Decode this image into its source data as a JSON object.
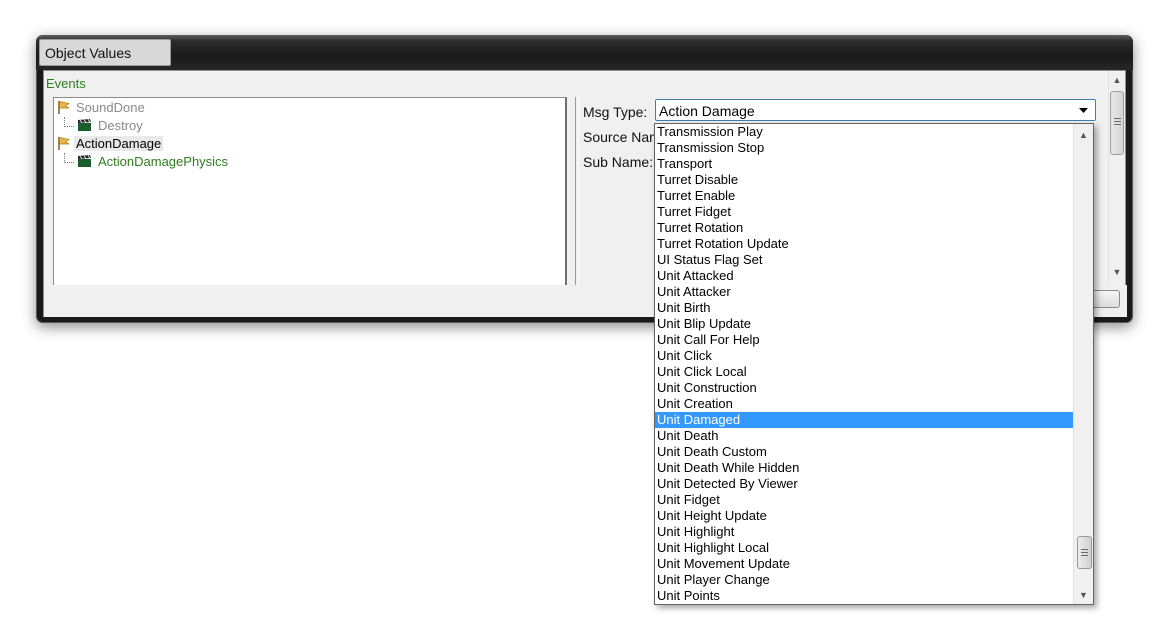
{
  "window": {
    "title": "Object Values"
  },
  "events_label": "Events",
  "tree": {
    "items": [
      {
        "label": "SoundDone",
        "icon": "flag-icon",
        "color": "#8a8a8a"
      },
      {
        "label": "Destroy",
        "icon": "clapperboard-icon",
        "color": "#8a8a8a"
      },
      {
        "label": "ActionDamage",
        "icon": "flag-icon",
        "color": "#000000",
        "selected": true
      },
      {
        "label": "ActionDamagePhysics",
        "icon": "clapperboard-icon",
        "color": "#2e7d1f"
      }
    ]
  },
  "properties": {
    "msg_type_label": "Msg Type:",
    "source_name_label": "Source Nan",
    "sub_name_label": "Sub Name:",
    "msg_type_value": "Action Damage"
  },
  "dropdown": {
    "options": [
      "Transmission Play",
      "Transmission Stop",
      "Transport",
      "Turret Disable",
      "Turret Enable",
      "Turret Fidget",
      "Turret Rotation",
      "Turret Rotation Update",
      "UI Status Flag Set",
      "Unit Attacked",
      "Unit Attacker",
      "Unit Birth",
      "Unit Blip Update",
      "Unit Call For Help",
      "Unit Click",
      "Unit Click Local",
      "Unit Construction",
      "Unit Creation",
      "Unit Damaged",
      "Unit Death",
      "Unit Death Custom",
      "Unit Death While Hidden",
      "Unit Detected By Viewer",
      "Unit Fidget",
      "Unit Height Update",
      "Unit Highlight",
      "Unit Highlight Local",
      "Unit Movement Update",
      "Unit Player Change",
      "Unit Points"
    ],
    "highlighted": "Unit Damaged",
    "highlight_color": "#3399ff"
  }
}
